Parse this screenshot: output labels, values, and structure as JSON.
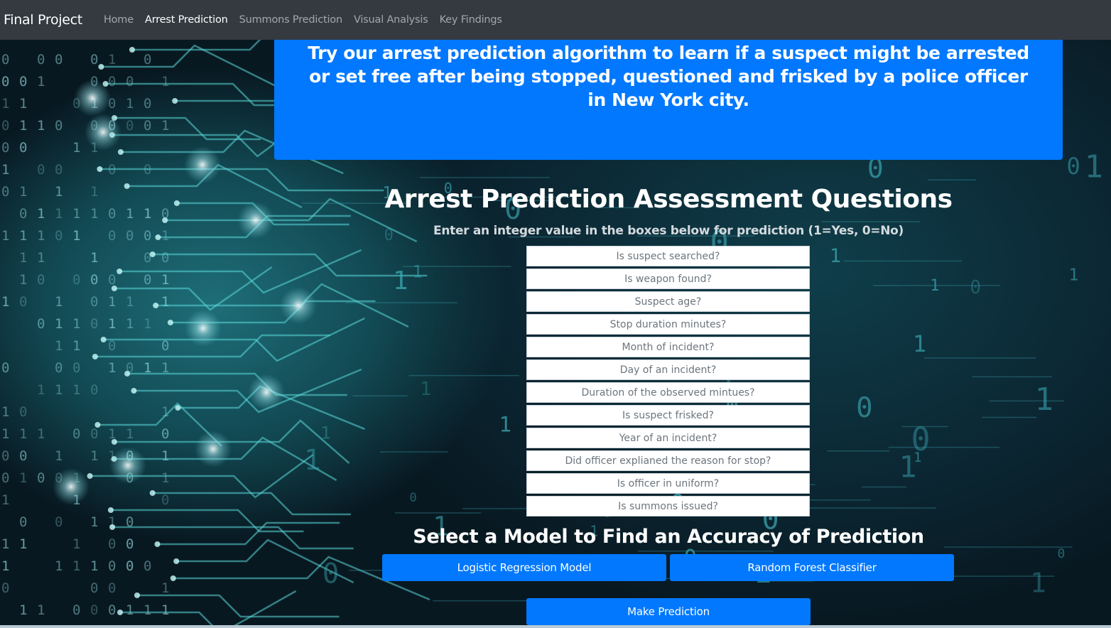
{
  "navbar": {
    "brand": "Final Project",
    "links": [
      {
        "label": "Home",
        "active": false
      },
      {
        "label": "Arrest Prediction",
        "active": true
      },
      {
        "label": "Summons Prediction",
        "active": false
      },
      {
        "label": "Visual Analysis",
        "active": false
      },
      {
        "label": "Key Findings",
        "active": false
      }
    ]
  },
  "hero": {
    "text": "Try our arrest prediction algorithm to learn if a suspect might be arrested or set free after being stopped, questioned and frisked by a police officer in New York city."
  },
  "questions": {
    "title": "Arrest Prediction Assessment Questions",
    "instructions": "Enter an integer value in the boxes below for prediction (1=Yes, 0=No)",
    "fields": [
      {
        "placeholder": "Is suspect searched?",
        "value": ""
      },
      {
        "placeholder": "Is weapon found?",
        "value": ""
      },
      {
        "placeholder": "Suspect age?",
        "value": ""
      },
      {
        "placeholder": "Stop duration minutes?",
        "value": ""
      },
      {
        "placeholder": "Month of incident?",
        "value": ""
      },
      {
        "placeholder": "Day of an incident?",
        "value": ""
      },
      {
        "placeholder": "Duration of the observed mintues?",
        "value": ""
      },
      {
        "placeholder": "Is suspect frisked?",
        "value": ""
      },
      {
        "placeholder": "Year of an incident?",
        "value": ""
      },
      {
        "placeholder": "Did officer explianed the reason for stop?",
        "value": ""
      },
      {
        "placeholder": "Is officer in uniform?",
        "value": ""
      },
      {
        "placeholder": "Is summons issued?",
        "value": ""
      }
    ]
  },
  "models": {
    "title": "Select a Model to Find an Accuracy of Prediction",
    "logistic_label": "Logistic Regression Model",
    "forest_label": "Random Forest Classifier"
  },
  "actions": {
    "predict_label": "Make Prediction"
  },
  "colors": {
    "navbar": "#343a40",
    "primary": "#0178fe",
    "background": "#0a1c26"
  }
}
